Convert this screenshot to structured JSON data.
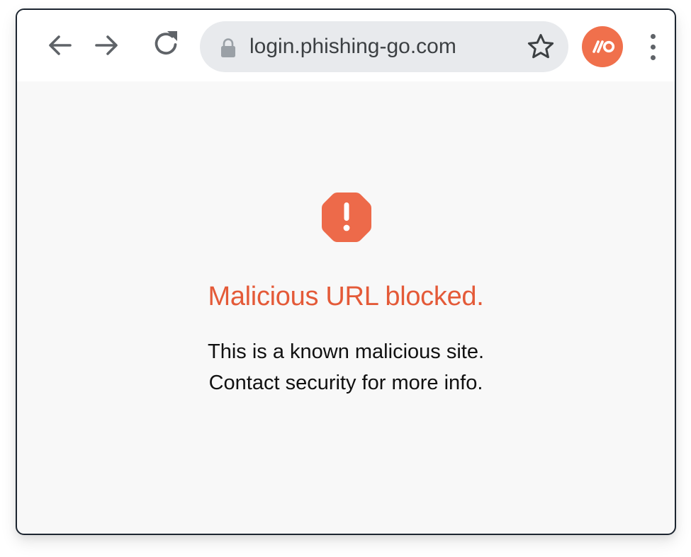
{
  "browser": {
    "url": "login.phishing-go.com",
    "icons": {
      "back": "arrow-left-icon",
      "forward": "arrow-right-icon",
      "reload": "reload-icon",
      "lock": "lock-icon",
      "bookmark": "star-icon",
      "profile": "profile-avatar",
      "menu": "more-vert-icon"
    },
    "avatar_color": "#f0704c"
  },
  "blocked_page": {
    "icon": "warning-octagon-icon",
    "icon_color": "#ed6a4a",
    "title": "Malicious URL blocked.",
    "title_color": "#e45a38",
    "message_lines": [
      "This is a known malicious site.",
      "Contact security for more info."
    ]
  }
}
